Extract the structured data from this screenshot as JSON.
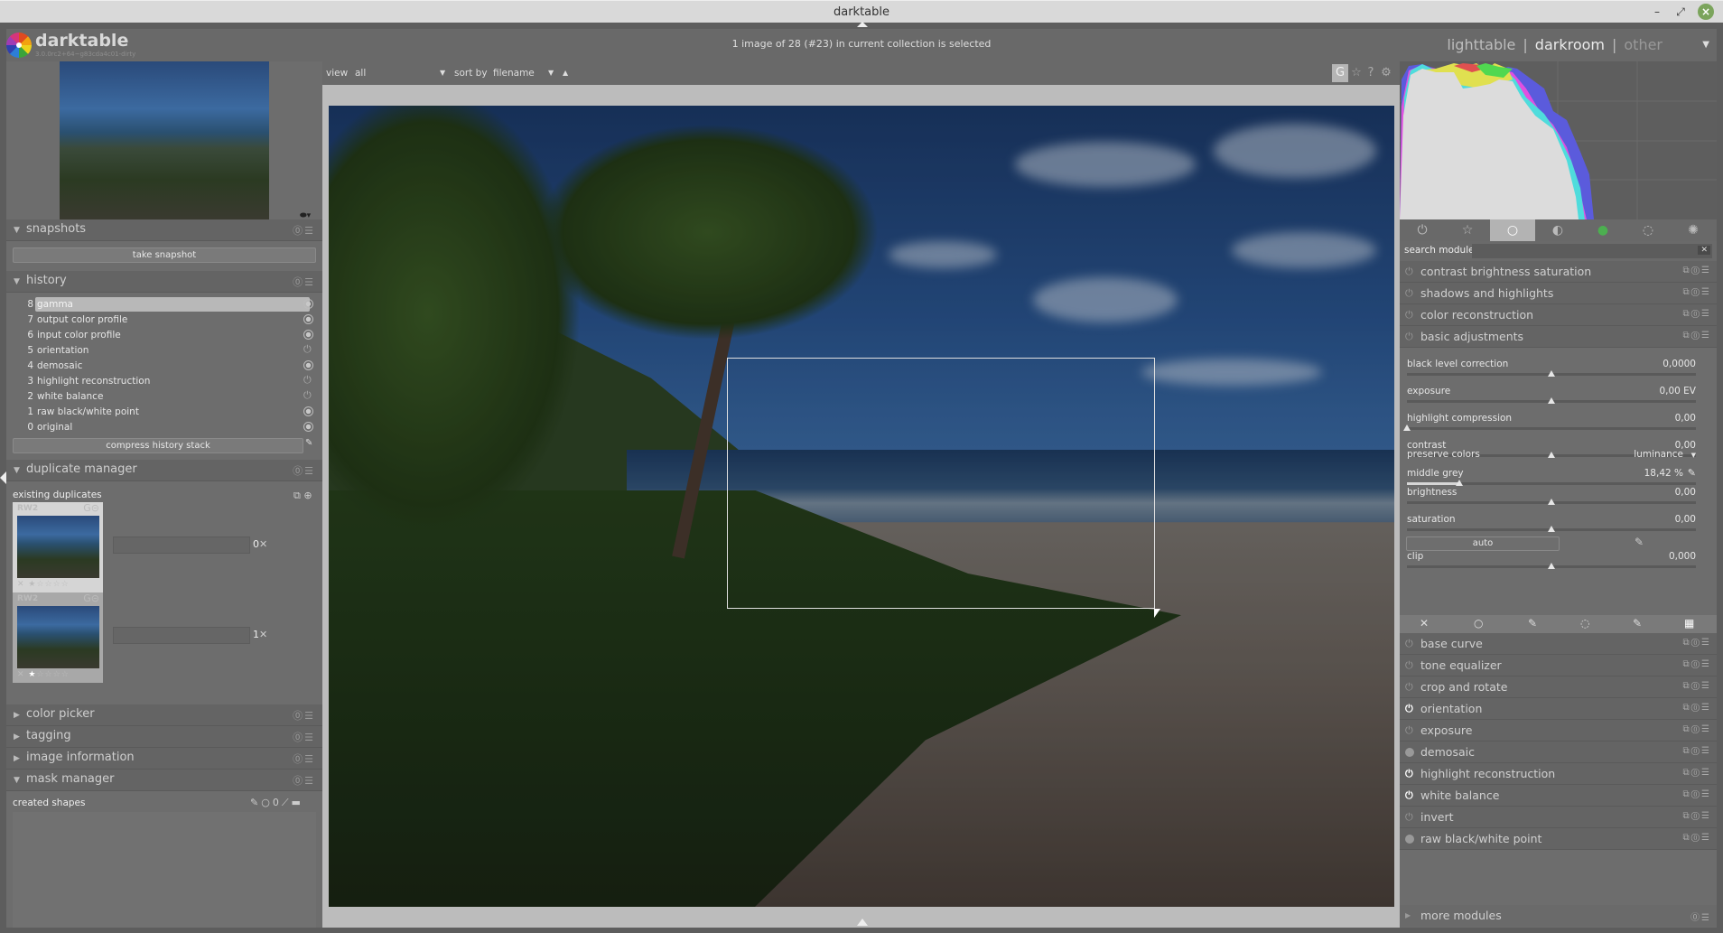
{
  "window": {
    "title": "darktable",
    "controls": [
      "minimize-icon",
      "maximize-icon",
      "close-icon"
    ]
  },
  "header": {
    "app_name": "darktable",
    "app_version": "3.0.0rc2+64~g83cda4c01-dirty",
    "status": "1 image of 28 (#23) in current collection is selected",
    "views": [
      {
        "label": "lighttable",
        "active": false
      },
      {
        "label": "darkroom",
        "active": true
      },
      {
        "label": "other",
        "active": false
      }
    ],
    "separator": "|"
  },
  "center_toolbar": {
    "view_label": "view",
    "view_value": "all",
    "sort_label": "sort by",
    "sort_value": "filename",
    "sort_dir": "▲",
    "icons": [
      {
        "name": "grouping-icon",
        "glyph": "G",
        "active": true
      },
      {
        "name": "star-overlay-icon",
        "glyph": "☆",
        "active": false
      },
      {
        "name": "help-icon",
        "glyph": "?",
        "active": false
      },
      {
        "name": "preferences-gear-icon",
        "glyph": "⚙",
        "active": false
      }
    ]
  },
  "left_panel": {
    "snapshots": {
      "title": "snapshots",
      "take_button": "take snapshot"
    },
    "history": {
      "title": "history",
      "items": [
        {
          "num": "8",
          "name": "gamma",
          "selected": true,
          "state": "always-on"
        },
        {
          "num": "7",
          "name": "output color profile",
          "selected": false,
          "state": "always-on"
        },
        {
          "num": "6",
          "name": "input color profile",
          "selected": false,
          "state": "always-on"
        },
        {
          "num": "5",
          "name": "orientation",
          "selected": false,
          "state": "power"
        },
        {
          "num": "4",
          "name": "demosaic",
          "selected": false,
          "state": "always-on"
        },
        {
          "num": "3",
          "name": "highlight reconstruction",
          "selected": false,
          "state": "power"
        },
        {
          "num": "2",
          "name": "white balance",
          "selected": false,
          "state": "power"
        },
        {
          "num": "1",
          "name": "raw black/white point",
          "selected": false,
          "state": "always-on"
        },
        {
          "num": "0",
          "name": "original",
          "selected": false,
          "state": "always-on"
        }
      ],
      "compress_button": "compress history stack"
    },
    "duplicate_manager": {
      "title": "duplicate manager",
      "existing_label": "existing duplicates",
      "duplicates": [
        {
          "format": "RW2",
          "version": "0",
          "rating": 0
        },
        {
          "format": "RW2",
          "version": "1",
          "rating": 1
        }
      ]
    },
    "collapsed_sections": [
      "color picker",
      "tagging",
      "image information"
    ],
    "mask_manager": {
      "title": "mask manager",
      "created_shapes_label": "created shapes"
    }
  },
  "right_panel": {
    "module_groups": [
      {
        "name": "active-modules-icon",
        "glyph": "⏻",
        "active": false
      },
      {
        "name": "favorites-icon",
        "glyph": "☆",
        "active": false
      },
      {
        "name": "basic-group-icon",
        "glyph": "○",
        "active": true
      },
      {
        "name": "tone-group-icon",
        "glyph": "◐",
        "active": false
      },
      {
        "name": "color-group-icon",
        "glyph": "●",
        "active": false
      },
      {
        "name": "correct-group-icon",
        "glyph": "◌",
        "active": false
      },
      {
        "name": "effect-group-icon",
        "glyph": "✺",
        "active": false
      }
    ],
    "search_label": "search module",
    "search_value": "",
    "modules_top": [
      {
        "label": "contrast brightness saturation",
        "power": "off"
      },
      {
        "label": "shadows and highlights",
        "power": "off"
      },
      {
        "label": "color reconstruction",
        "power": "off"
      },
      {
        "label": "basic adjustments",
        "power": "off"
      }
    ],
    "basic_adjustments": {
      "sliders": [
        {
          "name": "black level correction",
          "value": "0,0000",
          "position": 0.5
        },
        {
          "name": "exposure",
          "value": "0,00 EV",
          "position": 0.5
        },
        {
          "name": "highlight compression",
          "value": "0,00",
          "position": 0.0
        },
        {
          "name": "contrast",
          "value": "0,00",
          "position": 0.5
        }
      ],
      "preserve_colors_label": "preserve colors",
      "preserve_colors_value": "luminance",
      "middle_grey": {
        "name": "middle grey",
        "value": "18,42 %",
        "position": 0.18
      },
      "sliders2": [
        {
          "name": "brightness",
          "value": "0,00",
          "position": 0.5
        },
        {
          "name": "saturation",
          "value": "0,00",
          "position": 0.5
        }
      ],
      "auto_button": "auto",
      "clip": {
        "name": "clip",
        "value": "0,000",
        "position": 0.5
      }
    },
    "blend_modes": [
      "off-icon",
      "uniform-icon",
      "drawn-mask-icon",
      "parametric-mask-icon",
      "drawn-parametric-icon",
      "raster-mask-icon"
    ],
    "modules_bottom": [
      {
        "label": "base curve",
        "power": "off"
      },
      {
        "label": "tone equalizer",
        "power": "off"
      },
      {
        "label": "crop and rotate",
        "power": "off"
      },
      {
        "label": "orientation",
        "power": "on"
      },
      {
        "label": "exposure",
        "power": "off"
      },
      {
        "label": "demosaic",
        "power": "always"
      },
      {
        "label": "highlight reconstruction",
        "power": "on"
      },
      {
        "label": "white balance",
        "power": "on"
      },
      {
        "label": "invert",
        "power": "off"
      },
      {
        "label": "raw black/white point",
        "power": "always"
      }
    ],
    "more_modules": "more modules"
  },
  "colors": {
    "panel": "#6d6d6d",
    "background": "#5d5d5d",
    "selected": "#b8b8b8",
    "text": "#d6d6d6"
  }
}
